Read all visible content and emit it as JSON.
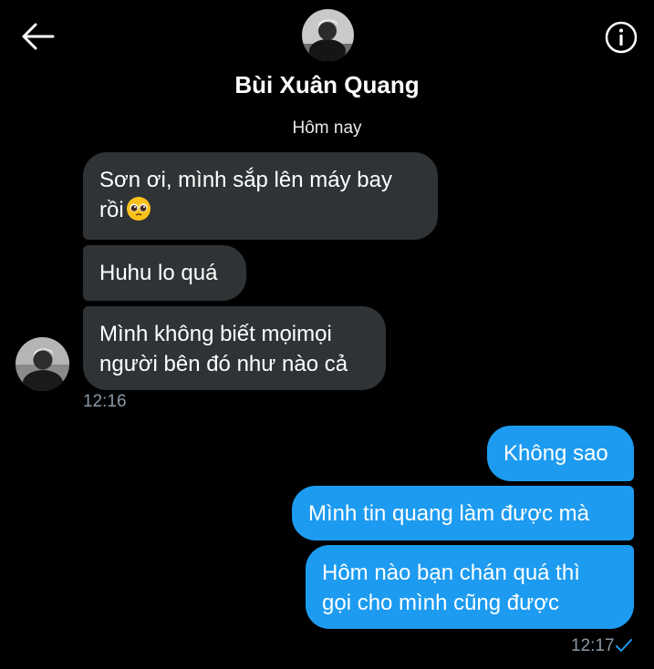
{
  "header": {
    "contact_name": "Bùi Xuân Quang",
    "back_icon": "back-arrow-icon",
    "info_icon": "info-icon"
  },
  "conversation": {
    "date_separator": "Hôm nay",
    "incoming": [
      {
        "text": "Sơn ơi, mình sắp lên máy bay",
        "text_line2": "rồi",
        "emoji": "pleading-face-emoji"
      },
      {
        "text": "Huhu lo quá"
      },
      {
        "text": "Mình không biết mọimọi",
        "text_line2": "người bên đó như nào cả"
      }
    ],
    "incoming_time": "12:16",
    "outgoing": [
      {
        "text": "Không sao"
      },
      {
        "text": "Mình tin quang làm được mà"
      },
      {
        "text": "Hôm nào bạn chán quá thì",
        "text_line2": "gọi cho mình cũng được"
      }
    ],
    "outgoing_time": "12:17",
    "read_status_icon": "checkmark-icon"
  },
  "colors": {
    "background": "#000000",
    "incoming_bubble": "#2f3336",
    "outgoing_bubble": "#1d9bf0",
    "meta_text": "#8b98a5"
  }
}
